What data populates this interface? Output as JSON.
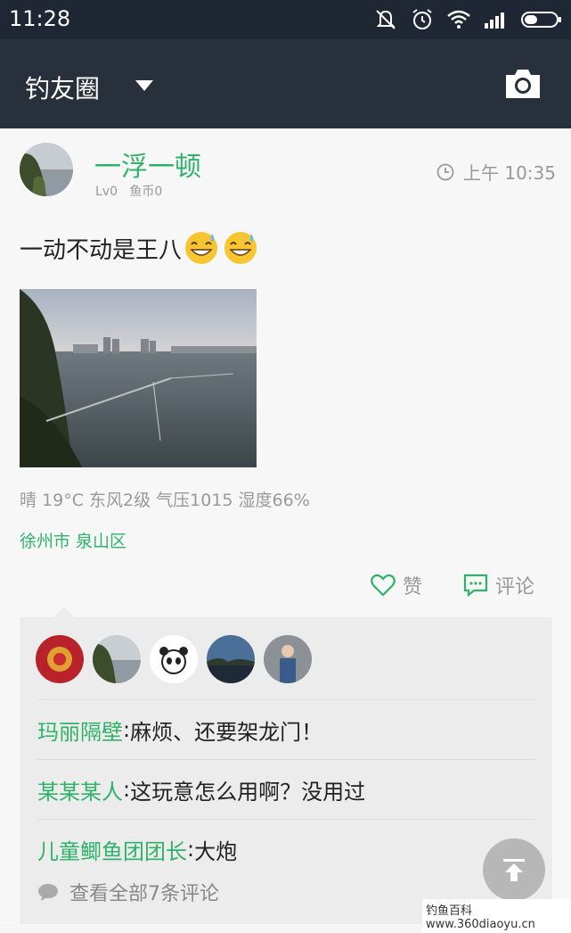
{
  "status_bar": {
    "time": "11:28",
    "icons": [
      "mute-icon",
      "alarm-icon",
      "wifi-icon",
      "signal-icon",
      "battery-icon"
    ]
  },
  "header": {
    "title": "钓友圈",
    "dropdown_icon": "caret-down-icon",
    "camera_icon": "camera-icon"
  },
  "post": {
    "username": "一浮一顿",
    "level": "Lv0",
    "coins": "鱼币0",
    "time": "上午 10:35",
    "text": "一动不动是王八",
    "weather": "晴  19°C  东风2级  气压1015  湿度66%",
    "location": "徐州市 泉山区",
    "like_label": "赞",
    "comment_label": "评论"
  },
  "comments": [
    {
      "name": "玛丽隔壁",
      "text": "麻烦、还要架龙门！"
    },
    {
      "name": "某某某人",
      "text": "这玩意怎么用啊？没用过"
    },
    {
      "name": "儿童鲫鱼团团长",
      "text": "大炮"
    }
  ],
  "view_all": "查看全部7条评论",
  "watermark": "钓鱼百科 www.360diaoyu.cn",
  "colors": {
    "accent": "#2fb36b",
    "header_bg": "#27303b"
  }
}
